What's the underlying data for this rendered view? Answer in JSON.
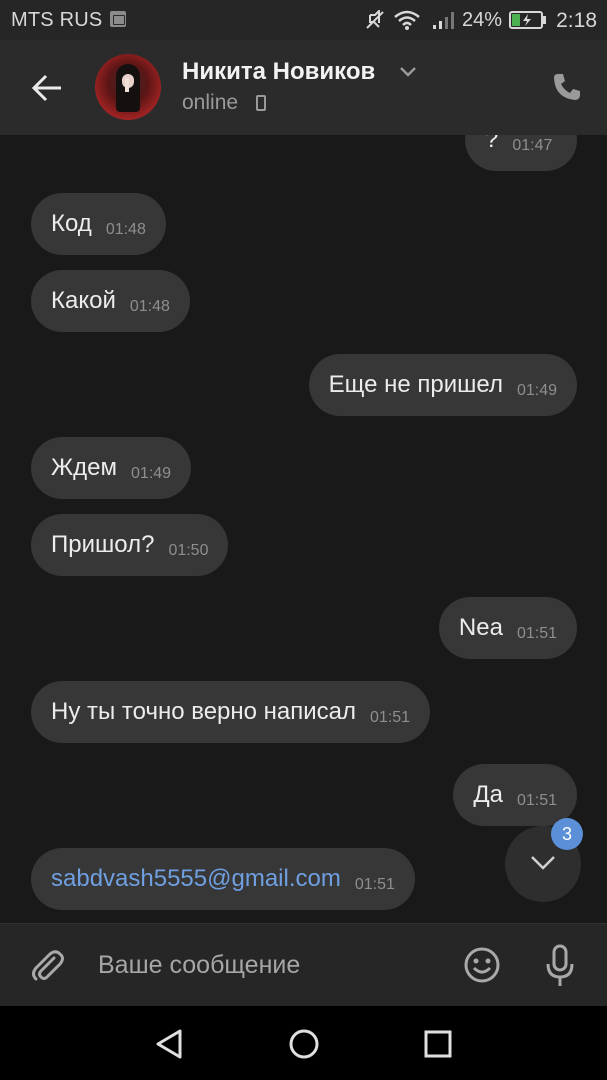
{
  "status_bar": {
    "carrier": "MTS RUS",
    "battery_percent": "24%",
    "time": "2:18",
    "icons": [
      "sim-image-icon",
      "mute-icon",
      "wifi-icon",
      "signal-icon",
      "battery-charging-icon"
    ]
  },
  "header": {
    "contact_name": "Никита Новиков",
    "status": "online",
    "icons": [
      "back-arrow-icon",
      "chevron-down-icon",
      "mobile-device-icon",
      "phone-icon"
    ]
  },
  "messages": [
    {
      "side": "out",
      "text": "?",
      "time": "01:47"
    },
    {
      "side": "in",
      "text": "Код",
      "time": "01:48"
    },
    {
      "side": "in",
      "text": "Какой",
      "time": "01:48"
    },
    {
      "side": "out",
      "text": "Еще не пришел",
      "time": "01:49"
    },
    {
      "side": "in",
      "text": "Ждем",
      "time": "01:49"
    },
    {
      "side": "in",
      "text": "Пришол?",
      "time": "01:50"
    },
    {
      "side": "out",
      "text": "Nea",
      "time": "01:51"
    },
    {
      "side": "in",
      "text": "Ну ты точно верно написал",
      "time": "01:51"
    },
    {
      "side": "out",
      "text": "Да",
      "time": "01:51"
    },
    {
      "side": "in",
      "text": "sabdvash5555@gmail.com",
      "time": "01:51",
      "is_link": true
    }
  ],
  "scroll_down": {
    "unread_count": "3"
  },
  "composer": {
    "placeholder": "Ваше сообщение",
    "icons": [
      "paperclip-icon",
      "emoji-icon",
      "microphone-icon"
    ]
  },
  "nav_bar": {
    "icons": [
      "nav-back-icon",
      "nav-home-icon",
      "nav-recent-icon"
    ]
  },
  "colors": {
    "background": "#19191a",
    "header": "#2b2b2b",
    "bubble": "#373738",
    "link": "#6f9fe0",
    "badge": "#5b8fd8"
  }
}
